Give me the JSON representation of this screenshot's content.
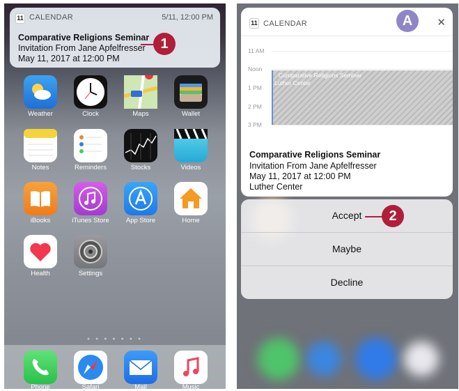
{
  "left_screen": {
    "notification": {
      "app_name": "CALENDAR",
      "calendar_icon_day": "11",
      "timestamp": "5/11, 12:00 PM",
      "title": "Comparative Religions Seminar",
      "subtitle": "Invitation From Jane Apfelfresser",
      "datetime": "May 11, 2017 at 12:00 PM"
    },
    "callout": "1",
    "apps": [
      {
        "label": "Weather",
        "icon": "weather-icon",
        "color": "#2f8fe8"
      },
      {
        "label": "Clock",
        "icon": "clock-icon",
        "color": "#111111"
      },
      {
        "label": "Maps",
        "icon": "maps-icon",
        "color": "#d9d5c8"
      },
      {
        "label": "Wallet",
        "icon": "wallet-icon",
        "color": "#1b1b1b"
      },
      {
        "label": "Notes",
        "icon": "notes-icon",
        "color": "#f5d33b"
      },
      {
        "label": "Reminders",
        "icon": "reminders-icon",
        "color": "#ffffff"
      },
      {
        "label": "Stocks",
        "icon": "stocks-icon",
        "color": "#111111"
      },
      {
        "label": "Videos",
        "icon": "videos-icon",
        "color": "#39c2e0"
      },
      {
        "label": "iBooks",
        "icon": "ibooks-icon",
        "color": "#f08a24"
      },
      {
        "label": "iTunes Store",
        "icon": "itunes-store-icon",
        "color": "#c64bd8"
      },
      {
        "label": "App Store",
        "icon": "app-store-icon",
        "color": "#1f8df0"
      },
      {
        "label": "Home",
        "icon": "home-icon",
        "color": "#ffffff"
      },
      {
        "label": "Health",
        "icon": "health-icon",
        "color": "#ffffff"
      },
      {
        "label": "Settings",
        "icon": "settings-icon",
        "color": "#8e8e93"
      }
    ],
    "dock": [
      {
        "label": "Phone",
        "icon": "phone-icon",
        "color": "#3fd158"
      },
      {
        "label": "Safari",
        "icon": "safari-icon",
        "color": "#ffffff"
      },
      {
        "label": "Mail",
        "icon": "mail-icon",
        "color": "#2a7ef5"
      },
      {
        "label": "Music",
        "icon": "music-icon",
        "color": "#ffffff"
      }
    ],
    "page_dots": "● ● ● ● ● ● ●"
  },
  "right_screen": {
    "header": {
      "app_name": "CALENDAR",
      "calendar_icon_day": "11",
      "close_glyph": "✕"
    },
    "callout_a": "A",
    "hours": [
      "11 AM",
      "Noon",
      "1 PM",
      "2 PM",
      "3 PM"
    ],
    "event_block": {
      "title": "Comparative Religions Seminar",
      "location": "Luther Center"
    },
    "details": {
      "title": "Comparative Religions Seminar",
      "subtitle": "Invitation From Jane Apfelfresser",
      "datetime": "May 11, 2017 at 12:00 PM",
      "location": "Luther Center"
    },
    "actions": {
      "accept": "Accept",
      "maybe": "Maybe",
      "decline": "Decline"
    },
    "callout": "2"
  }
}
